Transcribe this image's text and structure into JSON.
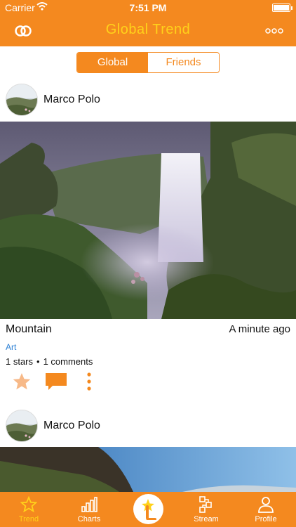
{
  "status_bar": {
    "carrier": "Carrier",
    "time": "7:51 PM"
  },
  "nav": {
    "title": "Global Trend",
    "left_icon": "link-rings-icon",
    "right_icon": "more-dots-icon"
  },
  "segments": {
    "items": [
      "Global",
      "Friends"
    ],
    "selected": "Global"
  },
  "posts": [
    {
      "author": "Marco Polo",
      "title": "Mountain",
      "time": "A minute ago",
      "tag": "Art",
      "stars": "1 stars",
      "comments": "1 comments"
    },
    {
      "author": "Marco Polo"
    }
  ],
  "tab_bar": {
    "items": [
      {
        "label": "Trend",
        "icon": "star-icon",
        "active": true
      },
      {
        "label": "Charts",
        "icon": "bar-chart-icon",
        "active": false
      },
      {
        "label": "",
        "icon": "center-logo-icon",
        "active": false
      },
      {
        "label": "Stream",
        "icon": "stream-icon",
        "active": false
      },
      {
        "label": "Profile",
        "icon": "person-icon",
        "active": false
      }
    ]
  },
  "colors": {
    "accent": "#f4891f",
    "title_yellow": "#ffd21a",
    "tag_blue": "#2a7fd4",
    "star_fill": "#f7b988"
  }
}
